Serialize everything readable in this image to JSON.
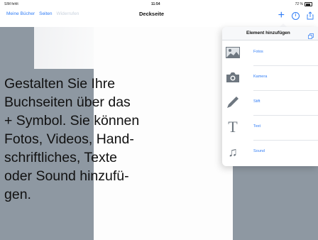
{
  "status_bar": {
    "carrier": "SIM fehlt",
    "time": "11:54",
    "battery": "72 %"
  },
  "navbar": {
    "links": [
      "Meine Bücher",
      "Seiten",
      "Widerrufen"
    ],
    "title": "Deckseite",
    "plus_icon": "plus-icon",
    "info_icon": "info-icon",
    "share_icon": "share-icon"
  },
  "popover": {
    "title": "Element hinzufügen",
    "items": [
      {
        "label": "Fotos",
        "icon": "photos-icon"
      },
      {
        "label": "Kamera",
        "icon": "camera-icon"
      },
      {
        "label": "Stift",
        "icon": "pen-icon"
      },
      {
        "label": "Text",
        "icon": "text-icon"
      },
      {
        "label": "Sound",
        "icon": "music-icon"
      }
    ]
  },
  "caption": {
    "text": "Gestalten Sie Ihre\nBuchseiten über das\n+ Symbol. Sie können\nFotos, Videos, Hand-\nschriftliches, Texte\noder Sound hinzufü-\ngen."
  },
  "colors": {
    "accent": "#2f7cf6",
    "canvas": "#8e98a2"
  }
}
